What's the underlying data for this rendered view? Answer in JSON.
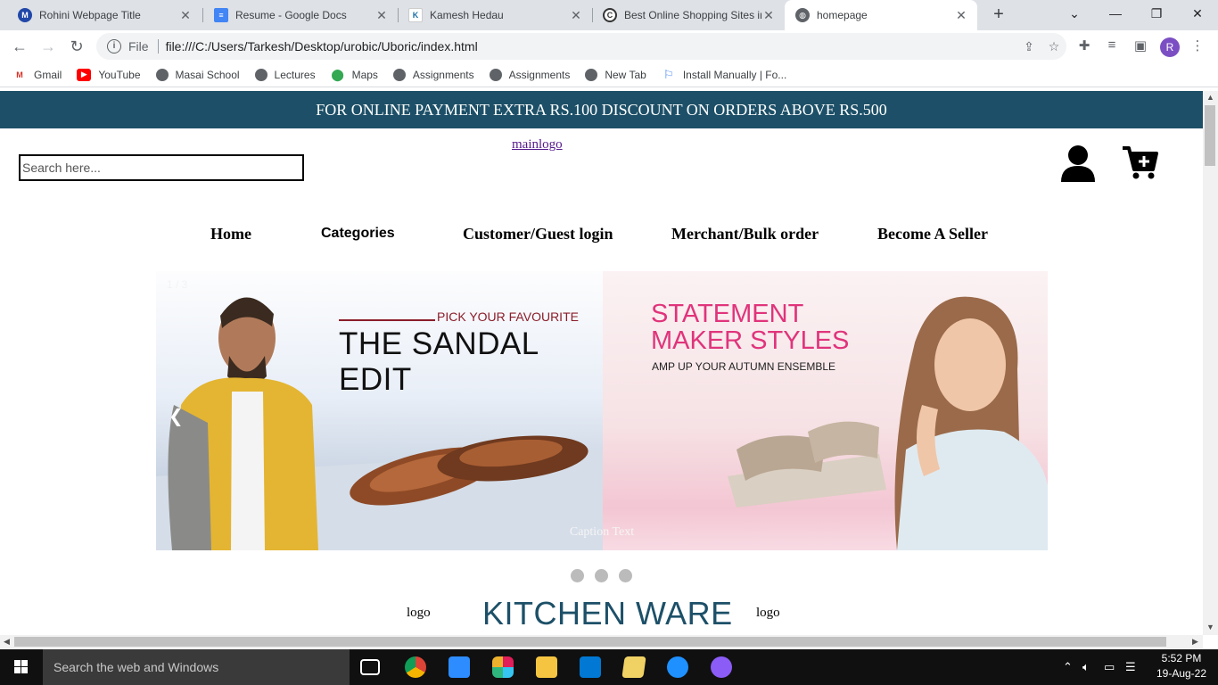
{
  "browser": {
    "tabs": [
      {
        "title": "Rohini Webpage Title",
        "favicon": "m-circle-icon",
        "active": false
      },
      {
        "title": "Resume - Google Docs",
        "favicon": "docs-icon",
        "active": false
      },
      {
        "title": "Kamesh Hedau",
        "favicon": "k-icon",
        "active": false
      },
      {
        "title": "Best Online Shopping Sites in",
        "favicon": "c-logo-icon",
        "active": false
      },
      {
        "title": "homepage",
        "favicon": "globe-icon",
        "active": true
      }
    ],
    "address": {
      "scheme_label": "File",
      "url": "file:///C:/Users/Tarkesh/Desktop/urobic/Uboric/index.html"
    },
    "profile_initial": "R",
    "bookmarks": [
      {
        "label": "Gmail",
        "icon": "gmail-icon"
      },
      {
        "label": "YouTube",
        "icon": "youtube-icon"
      },
      {
        "label": "Masai School",
        "icon": "globe-icon"
      },
      {
        "label": "Lectures",
        "icon": "globe-icon"
      },
      {
        "label": "Maps",
        "icon": "maps-icon"
      },
      {
        "label": "Assignments",
        "icon": "globe-icon"
      },
      {
        "label": "Assignments",
        "icon": "globe-icon"
      },
      {
        "label": "New Tab",
        "icon": "globe-icon"
      },
      {
        "label": "Install Manually | Fo...",
        "icon": "flag-icon"
      }
    ]
  },
  "page": {
    "promo_banner": "FOR ONLINE PAYMENT EXTRA RS.100 DISCOUNT ON ORDERS ABOVE RS.500",
    "search_placeholder": "Search here...",
    "main_logo_alt": "mainlogo",
    "nav": [
      "Home",
      "Categories",
      "Customer/Guest login",
      "Merchant/Bulk order",
      "Become A Seller"
    ],
    "slider": {
      "counter": "1 / 3",
      "caption": "Caption Text",
      "slide1": {
        "pick": "PICK YOUR FAVOURITE",
        "headline": "THE SANDAL EDIT"
      },
      "slide2": {
        "line1": "STATEMENT",
        "line2": "MAKER STYLES",
        "sub": "AMP UP YOUR AUTUMN ENSEMBLE"
      },
      "dot_count": 3
    },
    "section_title": "KITCHEN WARE",
    "logo_alt_left": "logo",
    "logo_alt_right": "logo"
  },
  "taskbar": {
    "search_text": "Search the web and Windows",
    "time": "5:52 PM",
    "date": "19-Aug-22"
  },
  "colors": {
    "brand": "#1d5068",
    "accent_pink": "#e0347b",
    "accent_red": "#8b1d2a"
  }
}
